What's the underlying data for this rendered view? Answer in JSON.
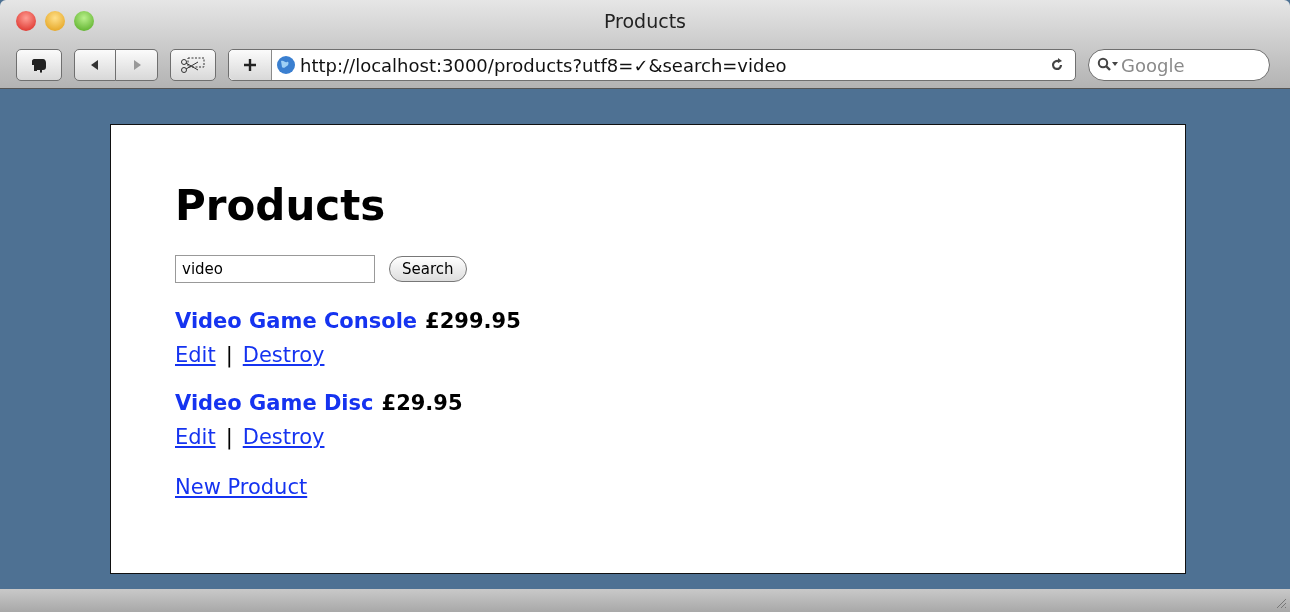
{
  "window": {
    "title": "Products"
  },
  "toolbar": {
    "url": "http://localhost:3000/products?utf8=✓&search=video",
    "search_placeholder": "Google"
  },
  "page": {
    "heading": "Products",
    "search": {
      "value": "video",
      "button": "Search"
    },
    "products": [
      {
        "name": "Video Game Console",
        "price": "£299.95",
        "actions": [
          "Edit",
          "Destroy"
        ],
        "separator": "|"
      },
      {
        "name": "Video Game Disc",
        "price": "£29.95",
        "actions": [
          "Edit",
          "Destroy"
        ],
        "separator": "|"
      }
    ],
    "new_link": "New Product"
  }
}
